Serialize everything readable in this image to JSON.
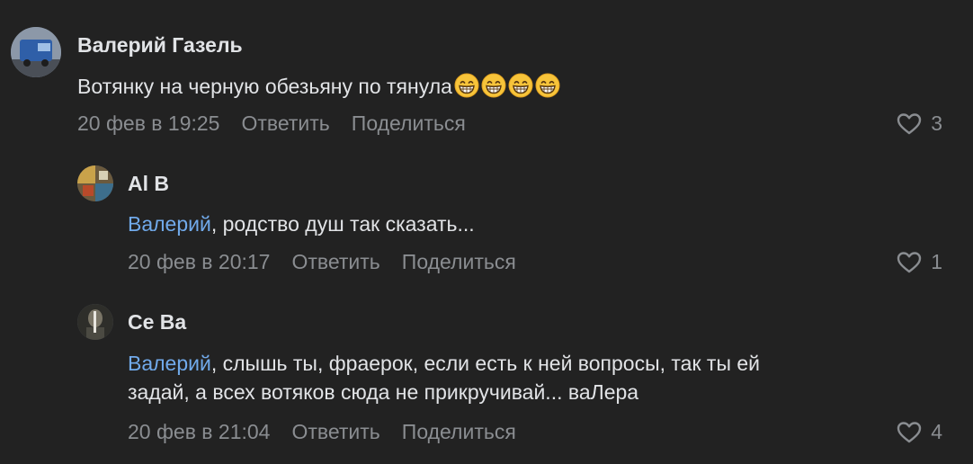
{
  "comments": [
    {
      "author": "Валерий Газель",
      "text": "Вотянку на черную обезьяну по тянула",
      "emoji_count": 4,
      "emoji": "grinning-face",
      "date": "20 фев в 19:25",
      "reply_label": "Ответить",
      "share_label": "Поделиться",
      "likes": "3"
    },
    {
      "author": "Al B",
      "mention": "Валерий",
      "text": ", родство душ так сказать...",
      "date": "20 фев в 20:17",
      "reply_label": "Ответить",
      "share_label": "Поделиться",
      "likes": "1"
    },
    {
      "author": "Ce Ba",
      "mention": "Валерий",
      "text_line1": ", слышь ты, фраерок, если есть к ней вопросы, так ты ей",
      "text_line2": "задай, а всех вотяков сюда не прикручивай... ваЛера",
      "date": "20 фев в 21:04",
      "reply_label": "Ответить",
      "share_label": "Поделиться",
      "likes": "4"
    }
  ],
  "colors": {
    "background": "#222222",
    "text": "#e1e3e6",
    "secondary": "#8a8d91",
    "link": "#71aaeb"
  },
  "icons": [
    "heart-outline-icon",
    "grinning-face-emoji"
  ]
}
